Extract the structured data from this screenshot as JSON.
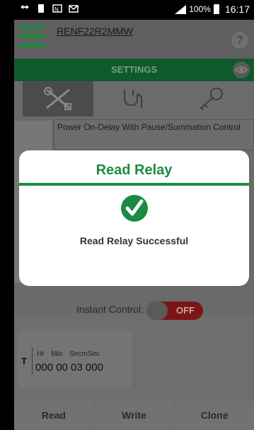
{
  "status_bar": {
    "battery": "100%",
    "time": "16:17",
    "icons": [
      "vpn-key-icon",
      "sim-icon",
      "nfc-icon",
      "mail-icon"
    ]
  },
  "header": {
    "device_name": "RENF22R2MMW",
    "help_label": "?"
  },
  "settings_bar": {
    "title": "SETTINGS"
  },
  "tabs": [
    {
      "icon": "tools-icon",
      "active": true
    },
    {
      "icon": "stethoscope-icon",
      "active": false
    },
    {
      "icon": "key-icon",
      "active": false
    }
  ],
  "content": {
    "description": "Power On-Delay With Pause/Summation Control"
  },
  "instant_control": {
    "label": "Instant Control:",
    "state": "OFF"
  },
  "timer": {
    "letter": "T",
    "headers": [
      "Hr",
      "Min",
      "Sec",
      "mSec"
    ],
    "value": "000 00 03 000"
  },
  "bottom_buttons": {
    "read": "Read",
    "write": "Write",
    "clone": "Clone"
  },
  "dialog": {
    "title": "Read Relay",
    "message": "Read Relay Successful",
    "icon": "check-circle-icon"
  },
  "colors": {
    "brand_green": "#1c8b42",
    "toggle_off": "#7a1616"
  }
}
